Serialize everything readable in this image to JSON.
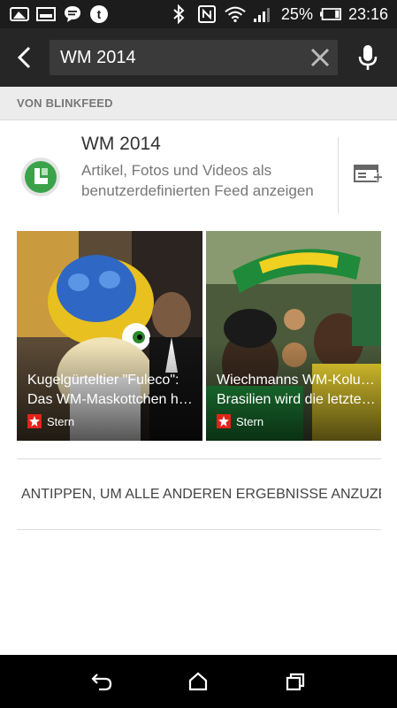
{
  "status_bar": {
    "icons_left": [
      "photo-icon",
      "gallery-icon",
      "chat-icon",
      "tumblr-icon"
    ],
    "icons_right": [
      "bluetooth-icon",
      "nfc-icon",
      "wifi-icon",
      "signal-icon"
    ],
    "battery": "25%",
    "time": "23:16"
  },
  "search": {
    "query": "WM 2014",
    "back_icon": "back-arrow-icon",
    "clear_icon": "close-icon",
    "mic_icon": "mic-icon"
  },
  "section": {
    "header": "VON BLINKFEED"
  },
  "feed": {
    "title": "WM 2014",
    "description": "Artikel, Fotos und Videos als benutzerdefinierten Feed anzeigen",
    "add_icon": "add-feed-icon"
  },
  "tiles": [
    {
      "line1": "Kugelgürteltier \"Fuleco\":",
      "line2": "Das WM-Maskottchen hei…",
      "source": "Stern"
    },
    {
      "line1": "Wiechmanns WM-Kolumne:",
      "line2": "Brasilien wird die letzte…",
      "source": "Stern"
    }
  ],
  "more_results": "ANTIPPEN, UM ALLE ANDEREN ERGEBNISSE ANZUZEI…",
  "nav": [
    "back-icon",
    "home-icon",
    "recent-apps-icon"
  ],
  "colors": {
    "status_bg": "#1c1c1c",
    "search_bg": "#262626",
    "accent_green": "#3aa34a",
    "stern_red": "#e2231a"
  }
}
